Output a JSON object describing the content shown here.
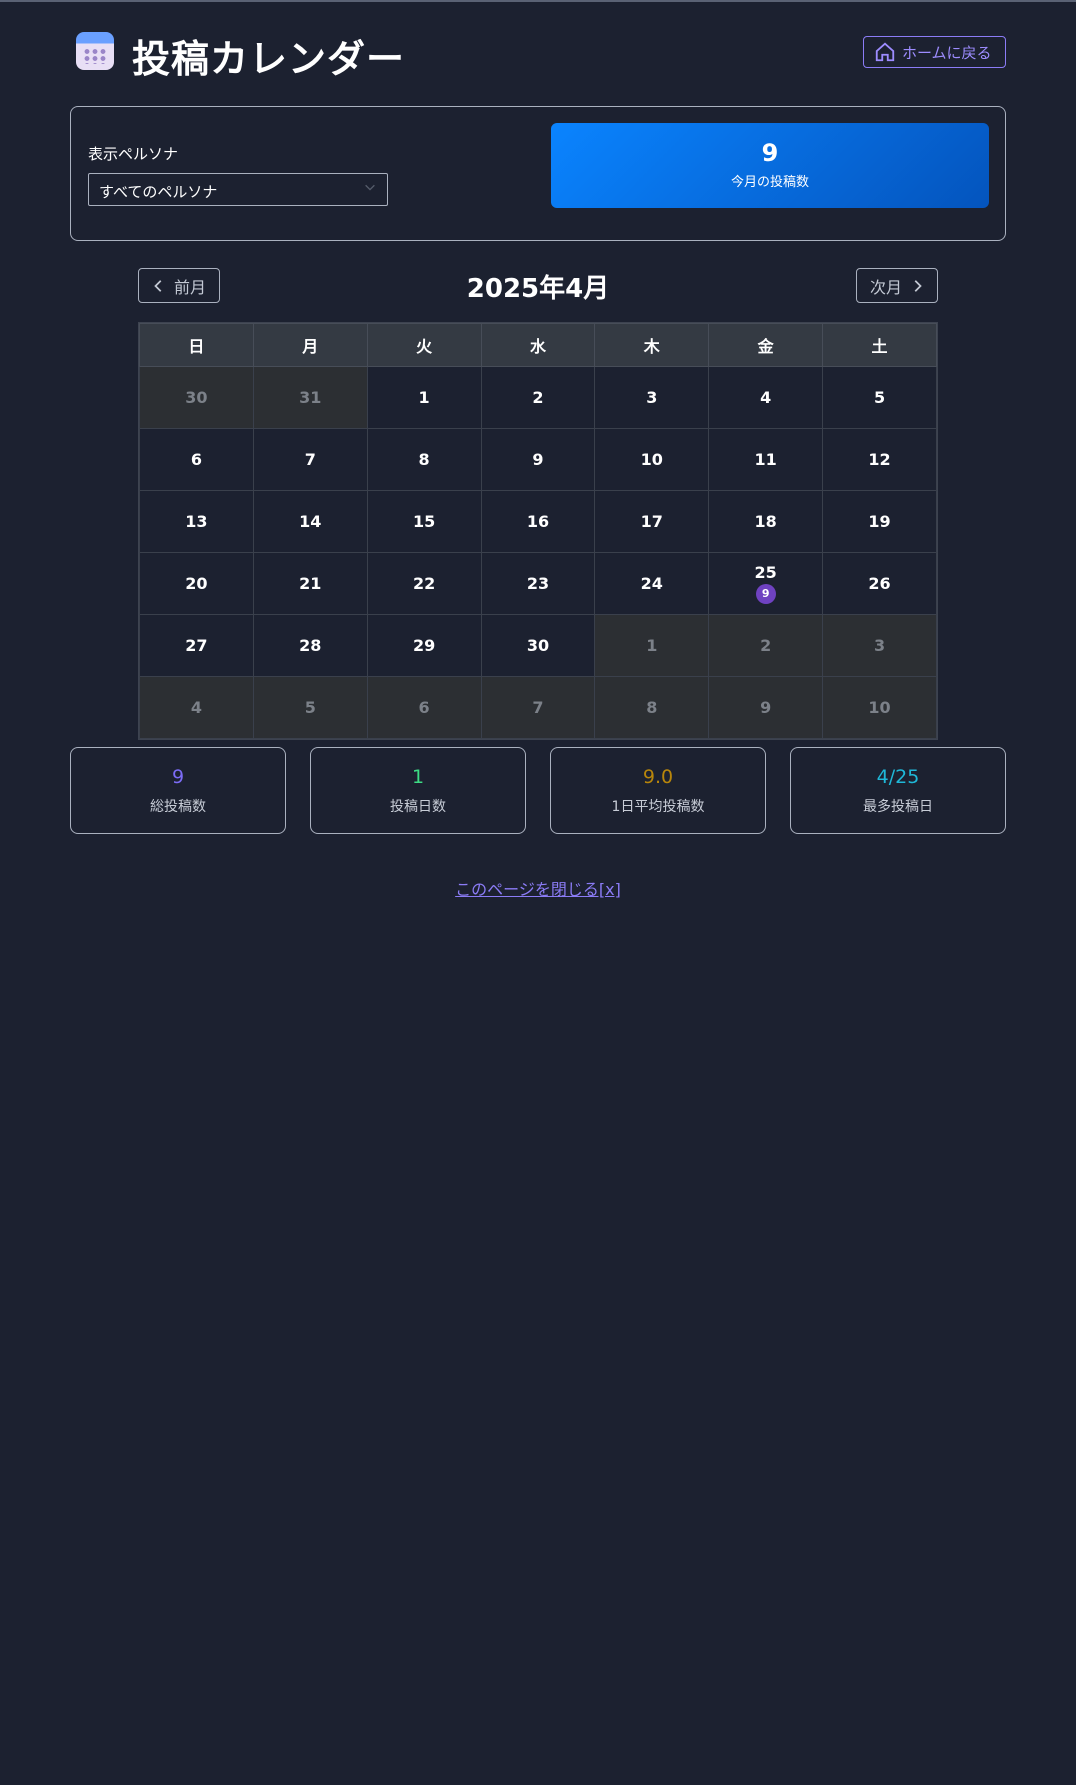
{
  "header": {
    "title": "投稿カレンダー",
    "home_label": "ホームに戻る"
  },
  "filter": {
    "label": "表示ペルソナ",
    "selected": "すべてのペルソナ"
  },
  "month_count": {
    "value": "9",
    "label": "今月の投稿数"
  },
  "nav": {
    "prev_label": "前月",
    "next_label": "次月",
    "month": "2025年4月"
  },
  "weekdays": [
    "日",
    "月",
    "火",
    "水",
    "木",
    "金",
    "土"
  ],
  "weeks": [
    [
      {
        "d": "30",
        "o": true
      },
      {
        "d": "31",
        "o": true
      },
      {
        "d": "1"
      },
      {
        "d": "2"
      },
      {
        "d": "3"
      },
      {
        "d": "4"
      },
      {
        "d": "5"
      }
    ],
    [
      {
        "d": "6"
      },
      {
        "d": "7"
      },
      {
        "d": "8"
      },
      {
        "d": "9"
      },
      {
        "d": "10"
      },
      {
        "d": "11"
      },
      {
        "d": "12"
      }
    ],
    [
      {
        "d": "13"
      },
      {
        "d": "14"
      },
      {
        "d": "15"
      },
      {
        "d": "16"
      },
      {
        "d": "17"
      },
      {
        "d": "18"
      },
      {
        "d": "19"
      }
    ],
    [
      {
        "d": "20"
      },
      {
        "d": "21"
      },
      {
        "d": "22"
      },
      {
        "d": "23"
      },
      {
        "d": "24"
      },
      {
        "d": "25",
        "count": "9"
      },
      {
        "d": "26"
      }
    ],
    [
      {
        "d": "27"
      },
      {
        "d": "28"
      },
      {
        "d": "29"
      },
      {
        "d": "30"
      },
      {
        "d": "1",
        "o": true
      },
      {
        "d": "2",
        "o": true
      },
      {
        "d": "3",
        "o": true
      }
    ],
    [
      {
        "d": "4",
        "o": true
      },
      {
        "d": "5",
        "o": true
      },
      {
        "d": "6",
        "o": true
      },
      {
        "d": "7",
        "o": true
      },
      {
        "d": "8",
        "o": true
      },
      {
        "d": "9",
        "o": true
      },
      {
        "d": "10",
        "o": true
      }
    ]
  ],
  "stats": [
    {
      "value": "9",
      "label": "総投稿数",
      "color": "#7c6cf6"
    },
    {
      "value": "1",
      "label": "投稿日数",
      "color": "#3ddc84"
    },
    {
      "value": "9.0",
      "label": "1日平均投稿数",
      "color": "#b8860b"
    },
    {
      "value": "4/25",
      "label": "最多投稿日",
      "color": "#1fb8d8"
    }
  ],
  "footer": {
    "close_label": "このページを閉じる[x]"
  }
}
